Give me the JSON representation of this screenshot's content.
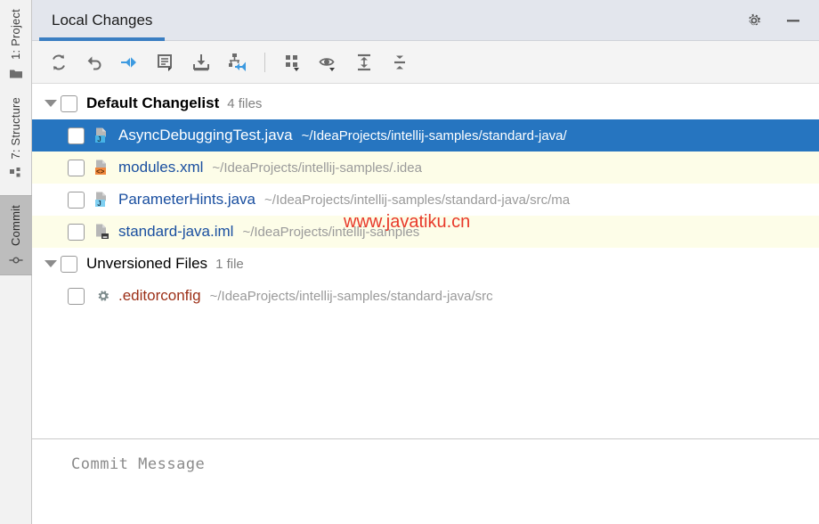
{
  "sidebar": {
    "items": [
      {
        "label": "1: Project",
        "icon": "folder-icon",
        "active": false
      },
      {
        "label": "7: Structure",
        "icon": "structure-grid-icon",
        "active": false
      },
      {
        "label": "Commit",
        "icon": "commit-node-icon",
        "active": true
      }
    ]
  },
  "header": {
    "tab_label": "Local Changes",
    "buttons": [
      {
        "name": "settings-button",
        "icon": "gear-icon"
      },
      {
        "name": "minimize-button",
        "icon": "minimize-icon"
      }
    ]
  },
  "toolbar": {
    "buttons": [
      {
        "name": "refresh-button",
        "icon": "refresh-icon",
        "tooltip": "Refresh"
      },
      {
        "name": "rollback-button",
        "icon": "rollback-undo-icon",
        "tooltip": "Rollback"
      },
      {
        "name": "show-diff-button",
        "icon": "show-diff-icon",
        "tooltip": "Show Diff"
      },
      {
        "name": "edit-source-button",
        "icon": "edit-source-icon",
        "tooltip": "Edit Source"
      },
      {
        "name": "update-project-button",
        "icon": "update-download-icon",
        "tooltip": "Update Project"
      },
      {
        "name": "shelve-changes-button",
        "icon": "shelve-changes-icon",
        "tooltip": "Shelve Silently"
      },
      {
        "name": "group-by-button",
        "icon": "group-by-grid-icon",
        "tooltip": "Group By"
      },
      {
        "name": "preview-diff-button",
        "icon": "eye-preview-icon",
        "tooltip": "Preview Diff"
      },
      {
        "name": "expand-all-button",
        "icon": "expand-all-icon",
        "tooltip": "Expand All"
      },
      {
        "name": "collapse-all-button",
        "icon": "collapse-all-icon",
        "tooltip": "Collapse All"
      }
    ]
  },
  "changes_tree": {
    "groups": [
      {
        "name": "Default Changelist",
        "count_label": "4 files",
        "expanded": true,
        "checked": false,
        "files": [
          {
            "name": "AsyncDebuggingTest.java",
            "path": "~/IdeaProjects/intellij-samples/standard-java/",
            "icon": "java-file-icon",
            "kind": "java",
            "selected": true,
            "checked": false,
            "alt": false
          },
          {
            "name": "modules.xml",
            "path": "~/IdeaProjects/intellij-samples/.idea",
            "icon": "xml-file-icon",
            "kind": "xml",
            "selected": false,
            "checked": false,
            "alt": true
          },
          {
            "name": "ParameterHints.java",
            "path": "~/IdeaProjects/intellij-samples/standard-java/src/ma",
            "icon": "java-file-icon",
            "kind": "java",
            "selected": false,
            "checked": false,
            "alt": false
          },
          {
            "name": "standard-java.iml",
            "path": "~/IdeaProjects/intellij-samples",
            "icon": "iml-module-file-icon",
            "kind": "iml",
            "selected": false,
            "checked": false,
            "alt": true
          }
        ]
      },
      {
        "name": "Unversioned Files",
        "count_label": "1 file",
        "expanded": true,
        "checked": false,
        "files": [
          {
            "name": ".editorconfig",
            "path": "~/IdeaProjects/intellij-samples/standard-java/src",
            "icon": "editorconfig-gear-icon",
            "kind": "unv",
            "selected": false,
            "checked": false,
            "alt": false
          }
        ]
      }
    ]
  },
  "commit": {
    "placeholder": "Commit Message"
  },
  "watermark": {
    "text": "www.javatiku.cn"
  },
  "colors": {
    "selection_blue": "#2675c0",
    "tab_underline": "#3a7ec2",
    "alt_row": "#fdfde8",
    "header_bg": "#e3e6ed",
    "toolbar_bg": "#f4f4f4",
    "link_blue": "#1a4fa0",
    "unversioned_red": "#9c2f17",
    "watermark_red": "#e8392a",
    "path_gray": "#9a9a9a"
  }
}
